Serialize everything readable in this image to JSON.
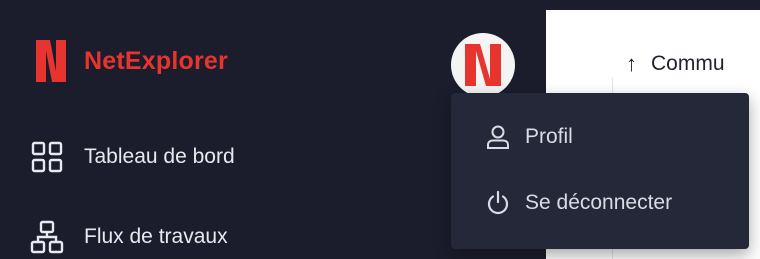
{
  "brand": {
    "name": "NetExplorer",
    "accent_color": "#e8342e",
    "logo_icon": "netexplorer-logo-icon"
  },
  "user_menu": {
    "avatar_icon": "netexplorer-avatar-icon",
    "items": [
      {
        "label": "Profil",
        "icon": "user-icon"
      },
      {
        "label": "Se déconnecter",
        "icon": "power-icon"
      }
    ]
  },
  "sidebar": {
    "items": [
      {
        "label": "Tableau de bord",
        "icon": "dashboard-grid-icon"
      },
      {
        "label": "Flux de travaux",
        "icon": "workflow-icon"
      }
    ]
  },
  "main": {
    "sort_column": {
      "label": "Commu",
      "direction_icon": "arrow-up-icon"
    }
  },
  "colors": {
    "sidebar_bg": "#1b1d2c",
    "dropdown_bg": "#252838",
    "text_light": "#e7e9f0"
  }
}
